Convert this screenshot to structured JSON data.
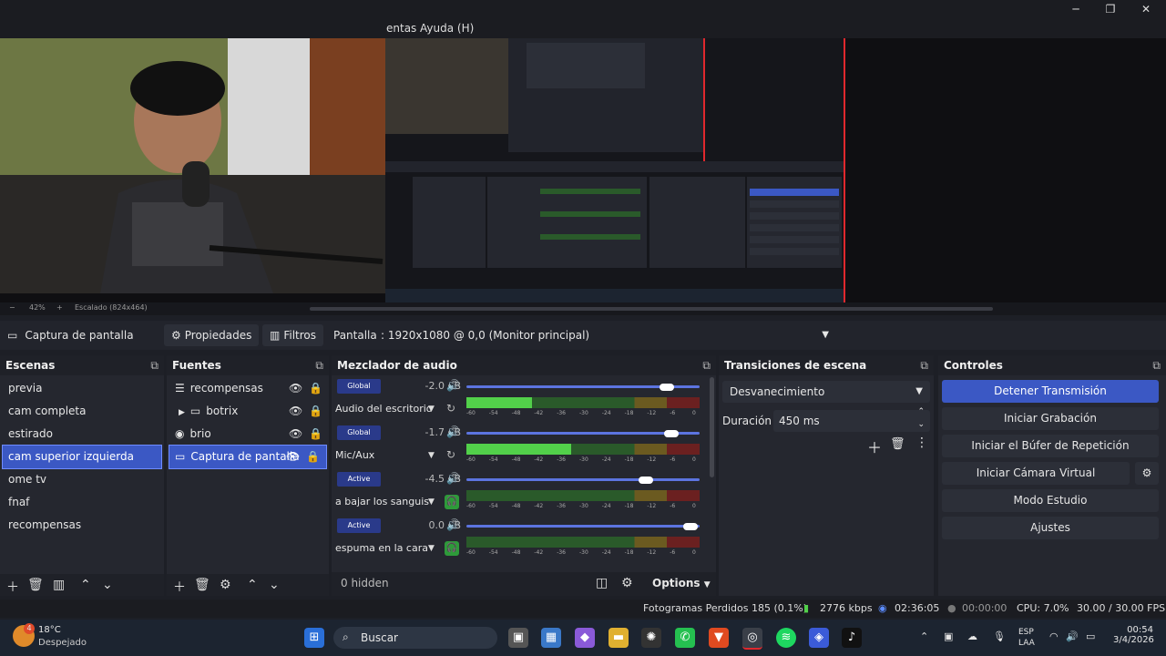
{
  "menu": {
    "items": [
      "entas",
      "Ayuda (H)"
    ]
  },
  "window_controls": {
    "minimize": "─",
    "maximize": "❐",
    "close": "✕"
  },
  "preview": {
    "zoom": "42%",
    "scale_label": "Escalado (824x464)",
    "zoom_minus": "−",
    "zoom_plus": "+"
  },
  "source_toolbar": {
    "source_name": "Captura de pantalla",
    "properties_label": "Propiedades",
    "filters_label": "Filtros",
    "screen_label": "Pantalla",
    "screen_value": ": 1920x1080 @ 0,0 (Monitor principal)"
  },
  "scenes": {
    "title": "Escenas",
    "items": [
      "previa",
      "cam completa",
      "estirado",
      "cam superior izquierda",
      "ome tv",
      "fnaf",
      "recompensas"
    ],
    "selected": "cam superior izquierda"
  },
  "sources": {
    "title": "Fuentes",
    "items": [
      {
        "label": "recompensas",
        "icon": "list-icon"
      },
      {
        "label": "botrix",
        "icon": "folder-icon"
      },
      {
        "label": "brio",
        "icon": "camera-icon"
      },
      {
        "label": "Captura de pantalla",
        "icon": "monitor-icon"
      }
    ],
    "selected": "Captura de pantalla"
  },
  "mixer": {
    "title": "Mezclador de audio",
    "channels": [
      {
        "badge": "Global",
        "db": "-2.0 dB",
        "name": "Audio del escritorio",
        "volume": 0.86,
        "level": 0.28
      },
      {
        "badge": "Global",
        "db": "-1.7 dB",
        "name": "Mic/Aux",
        "volume": 0.88,
        "level": 0.45
      },
      {
        "badge": "Active",
        "db": "-4.5 dB",
        "name": "a bajar los sanguis",
        "volume": 0.77,
        "level": 0.0
      },
      {
        "badge": "Active",
        "db": "0.0 dB",
        "name": "espuma en la cara",
        "volume": 0.96,
        "level": 0.0
      }
    ],
    "ticks": [
      "-60",
      "-54",
      "-48",
      "-42",
      "-36",
      "-30",
      "-24",
      "-18",
      "-12",
      "-6",
      "0"
    ],
    "hidden_label": "0 hidden",
    "options_label": "Options"
  },
  "transitions": {
    "title": "Transiciones de escena",
    "selected": "Desvanecimiento",
    "duration_label": "Duración",
    "duration_value": "450 ms"
  },
  "controls": {
    "title": "Controles",
    "buttons": [
      "Detener Transmisión",
      "Iniciar Grabación",
      "Iniciar el Búfer de Repetición",
      "Iniciar Cámara Virtual",
      "Modo Estudio",
      "Ajustes"
    ]
  },
  "status": {
    "dropped_frames": "Fotogramas Perdidos 185 (0.1%)",
    "bitrate": "2776 kbps",
    "stream_time": "02:36:05",
    "record_time": "00:00:00",
    "cpu": "CPU: 7.0%",
    "fps": "30.00 / 30.00 FPS"
  },
  "taskbar": {
    "weather_temp": "18°C",
    "weather_desc": "Despejado",
    "search_placeholder": "Buscar",
    "lang_top": "ESP",
    "lang_bottom": "LAA",
    "time": "00:54",
    "date": "3/4/2026",
    "weather_badge": "4"
  },
  "colors": {
    "accent": "#3b58c4",
    "live_border": "#e0282d",
    "meter_green": "#52d04a"
  }
}
